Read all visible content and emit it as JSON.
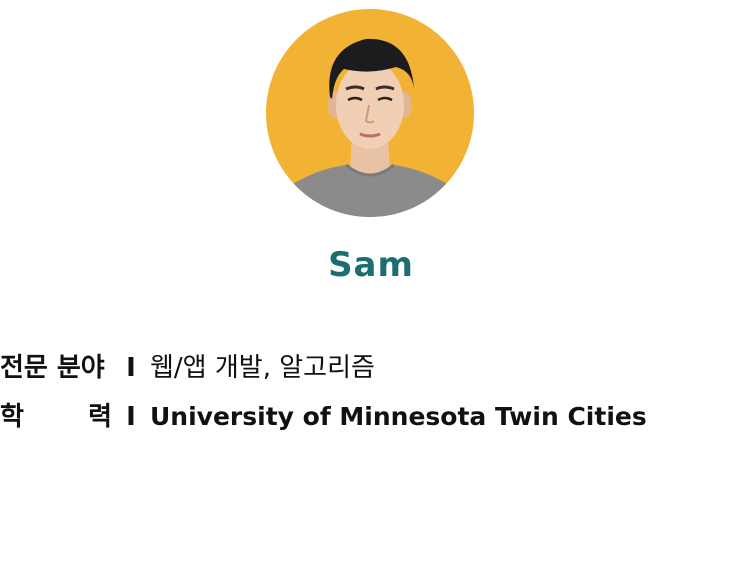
{
  "profile": {
    "name": "Sam",
    "name_color": "#1d6e70",
    "avatar_bg": "#f2b234"
  },
  "info": {
    "separator": "I",
    "field": {
      "label": "전문 분야",
      "value": "웹/앱 개발, 알고리즘"
    },
    "education": {
      "label_first": "학",
      "label_last": "력",
      "value": "University of Minnesota Twin Cities"
    }
  }
}
